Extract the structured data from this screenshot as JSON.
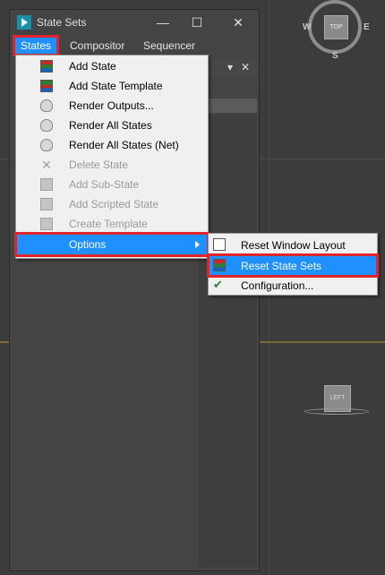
{
  "window": {
    "title": "State Sets",
    "minimize": "—",
    "maximize": "☐",
    "close": "✕"
  },
  "menubar": {
    "items": [
      {
        "label": "States"
      },
      {
        "label": "Compositor"
      },
      {
        "label": "Sequencer"
      }
    ]
  },
  "panel": {
    "dropdown_glyph": "▾",
    "close_glyph": "✕"
  },
  "dropdown": {
    "items": [
      {
        "label": "Add State",
        "enabled": true,
        "icon": "add-state-icon"
      },
      {
        "label": "Add State Template",
        "enabled": true,
        "icon": "state-template-icon"
      },
      {
        "label": "Render Outputs...",
        "enabled": true,
        "icon": "render-outputs-icon"
      },
      {
        "label": "Render All States",
        "enabled": true,
        "icon": "teapot-icon"
      },
      {
        "label": "Render All States (Net)",
        "enabled": true,
        "icon": "teapot-icon"
      },
      {
        "label": "Delete State",
        "enabled": false,
        "icon": "delete-icon"
      },
      {
        "label": "Add Sub-State",
        "enabled": false,
        "icon": "sub-state-icon"
      },
      {
        "label": "Add Scripted State",
        "enabled": false,
        "icon": "scripted-state-icon"
      },
      {
        "label": "Create Template",
        "enabled": false,
        "icon": "template-icon"
      },
      {
        "label": "Options",
        "enabled": true,
        "icon": "none",
        "submenu": true
      }
    ]
  },
  "submenu": {
    "items": [
      {
        "label": "Reset Window Layout",
        "icon": "layout-icon"
      },
      {
        "label": "Reset State Sets",
        "icon": "reset-state-sets-icon"
      },
      {
        "label": "Configuration...",
        "icon": "configuration-icon"
      }
    ]
  },
  "viewport": {
    "compass": {
      "top_label": "TOP",
      "w": "W",
      "e": "E",
      "s": "S"
    },
    "left_cube_label": "LEFT"
  },
  "colors": {
    "highlight": "#1e90ff",
    "callout_border": "#e0242c",
    "menu_bg": "#f0f0f0"
  }
}
